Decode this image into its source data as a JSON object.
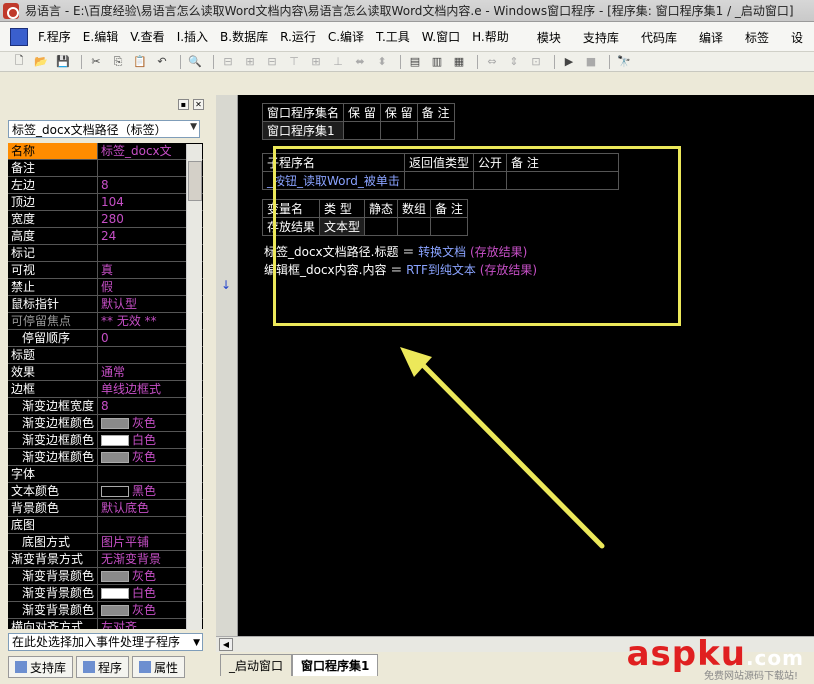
{
  "window": {
    "title": "易语言 - E:\\百度经验\\易语言怎么读取Word文档内容\\易语言怎么读取Word文档内容.e - Windows窗口程序 - [程序集: 窗口程序集1 / _启动窗口]"
  },
  "menubar": {
    "items": [
      "F.程序",
      "E.编辑",
      "V.查看",
      "I.插入",
      "B.数据库",
      "R.运行",
      "C.编译",
      "T.工具",
      "W.窗口",
      "H.帮助"
    ],
    "right_items": [
      "模块",
      "支持库",
      "代码库",
      "编译",
      "标签",
      "设"
    ]
  },
  "toolbar": {
    "buttons": [
      "new-icon",
      "open-icon",
      "save-icon",
      "cut-icon",
      "copy-icon",
      "paste-icon",
      "undo-icon",
      "redo-icon",
      "find-icon",
      "layout1-icon",
      "layout2-icon",
      "layout3-icon",
      "run-icon",
      "stop-icon",
      "debug-icon"
    ]
  },
  "properties": {
    "object_select": "标签_docx文档路径（标签）",
    "rows": [
      {
        "name": "名称",
        "value": "标签_docx文",
        "selected": true
      },
      {
        "name": "备注",
        "value": ""
      },
      {
        "name": "左边",
        "value": "8"
      },
      {
        "name": "顶边",
        "value": "104"
      },
      {
        "name": "宽度",
        "value": "280"
      },
      {
        "name": "高度",
        "value": "24"
      },
      {
        "name": "标记",
        "value": ""
      },
      {
        "name": "可视",
        "value": "真"
      },
      {
        "name": "禁止",
        "value": "假"
      },
      {
        "name": "鼠标指针",
        "value": "默认型"
      },
      {
        "name": "可停留焦点",
        "value": "** 无效 **",
        "dim": true
      },
      {
        "name": "停留顺序",
        "value": "0",
        "indent": true
      },
      {
        "name": "标题",
        "value": ""
      },
      {
        "name": "效果",
        "value": "通常"
      },
      {
        "name": "边框",
        "value": "单线边框式"
      },
      {
        "name": "渐变边框宽度",
        "value": "8",
        "indent": true
      },
      {
        "name": "渐变边框颜色",
        "value": "灰色",
        "indent": true,
        "swatch": "#8a8a8a"
      },
      {
        "name": "渐变边框颜色",
        "value": "白色",
        "indent": true,
        "swatch": "#ffffff"
      },
      {
        "name": "渐变边框颜色",
        "value": "灰色",
        "indent": true,
        "swatch": "#8a8a8a"
      },
      {
        "name": "字体",
        "value": ""
      },
      {
        "name": "文本颜色",
        "value": "黑色",
        "swatch": "#000000"
      },
      {
        "name": "背景颜色",
        "value": "默认底色"
      },
      {
        "name": "底图",
        "value": ""
      },
      {
        "name": "底图方式",
        "value": "图片平铺",
        "indent": true
      },
      {
        "name": "渐变背景方式",
        "value": "无渐变背景"
      },
      {
        "name": "渐变背景颜色",
        "value": "灰色",
        "indent": true,
        "swatch": "#8a8a8a"
      },
      {
        "name": "渐变背景颜色",
        "value": "白色",
        "indent": true,
        "swatch": "#ffffff"
      },
      {
        "name": "渐变背景颜色",
        "value": "灰色",
        "indent": true,
        "swatch": "#8a8a8a"
      },
      {
        "name": "横向对齐方式",
        "value": "左对齐"
      }
    ],
    "event_select": "在此处选择加入事件处理子程序",
    "tabs": [
      "支持库",
      "程序",
      "属性"
    ]
  },
  "code": {
    "assembly_table": {
      "headers": [
        "窗口程序集名",
        "保 留",
        "保 留",
        "备 注"
      ],
      "row": [
        "窗口程序集1",
        "",
        "",
        ""
      ]
    },
    "sub_table": {
      "headers": [
        "子程序名",
        "返回值类型",
        "公开",
        "备 注"
      ],
      "row": [
        "_按钮_读取Word_被单击",
        "",
        "",
        ""
      ]
    },
    "var_table": {
      "headers": [
        "变量名",
        "类 型",
        "静态",
        "数组",
        "备 注"
      ],
      "row": [
        "存放结果",
        "文本型",
        "",
        "",
        ""
      ]
    },
    "lines": [
      {
        "target": "标签_docx文档路径.标题",
        "op": "＝",
        "fn": "转换文档",
        "arg": "(存放结果)"
      },
      {
        "target": "编辑框_docx内容.内容",
        "op": "＝",
        "fn": "RTF到纯文本",
        "arg": "(存放结果)"
      }
    ]
  },
  "doc_tabs": [
    "_启动窗口",
    "窗口程序集1"
  ],
  "watermark": {
    "brand": "aspku",
    "suffix": ".com",
    "sub": "免费网站源码下载站!"
  },
  "colors": {
    "highlight": "#ece85a",
    "selected_prop": "#ff8c00",
    "prop_value": "#c64fc6",
    "watermark": "#e02020"
  }
}
